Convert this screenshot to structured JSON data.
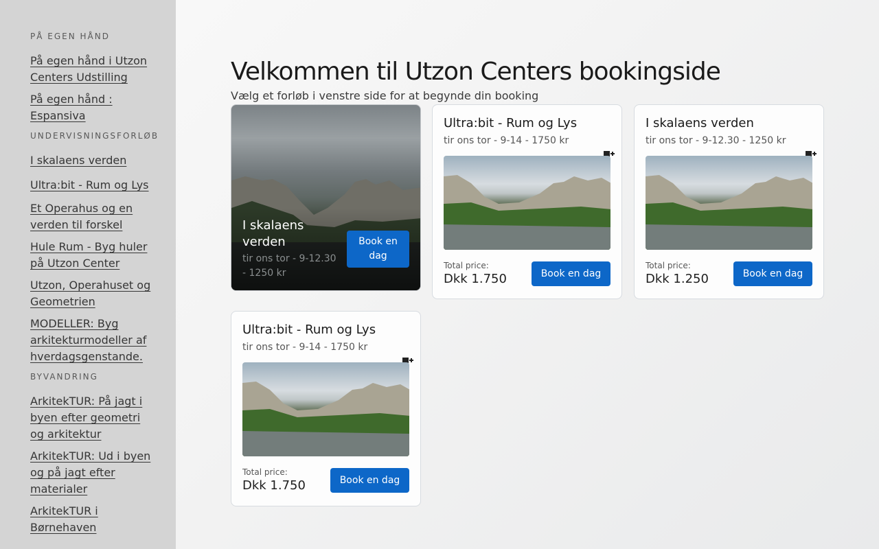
{
  "sidebar": {
    "sections": [
      {
        "heading": "PÅ EGEN HÅND",
        "links": [
          "På egen hånd i Utzon Centers Udstilling",
          "På egen hånd : Espansiva"
        ]
      },
      {
        "heading": "UNDERVISNINGSFORLØB",
        "links": [
          "I skalaens verden",
          "Ultra:bit - Rum og Lys",
          "Et Operahus og en verden til forskel",
          "Hule Rum - Byg huler på Utzon Center",
          "Utzon, Operahuset og Geometrien",
          "MODELLER: Byg arkitekturmodeller af hverdagsgenstande."
        ]
      },
      {
        "heading": "BYVANDRING",
        "links": [
          "ArkitekTUR: På jagt i byen efter geometri og arkitektur",
          "ArkitekTUR: Ud i byen og på jagt efter materialer",
          "ArkitekTUR i Børnehaven"
        ]
      }
    ]
  },
  "main": {
    "title": "Velkommen til Utzon Centers bookingside",
    "subtitle": "Vælg et forløb i venstre side for at begynde din booking"
  },
  "hero": {
    "title": "I skalaens verden",
    "subtitle": "tir ons tor - 9-12.30 - 1250 kr",
    "button": "Book en dag"
  },
  "cards": [
    {
      "title": "Ultra:bit - Rum og Lys",
      "subtitle": "tir ons tor - 9-14 - 1750 kr",
      "price_label": "Total price:",
      "price": "Dkk 1.750",
      "button": "Book en dag",
      "icon": "calendar-add-icon"
    },
    {
      "title": "I skalaens verden",
      "subtitle": "tir ons tor - 9-12.30 - 1250 kr",
      "price_label": "Total price:",
      "price": "Dkk 1.250",
      "button": "Book en dag",
      "icon": "calendar-add-icon"
    },
    {
      "title": "Ultra:bit - Rum og Lys",
      "subtitle": "tir ons tor - 9-14 - 1750 kr",
      "price_label": "Total price:",
      "price": "Dkk 1.750",
      "button": "Book en dag",
      "icon": "calendar-add-icon"
    }
  ],
  "colors": {
    "sidebar_bg": "#d4d4d4",
    "accent": "#0d67c8",
    "page_bg": "#f3f3f3"
  }
}
